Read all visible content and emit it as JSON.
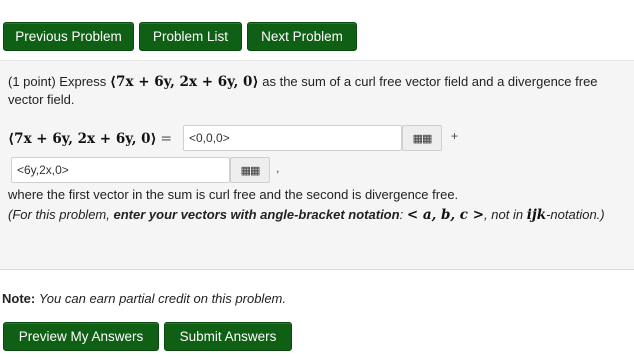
{
  "nav": {
    "previous_label": "Previous Problem",
    "list_label": "Problem List",
    "next_label": "Next Problem"
  },
  "problem": {
    "points": "(1 point) Express",
    "vector": "⟨7x + 6y, 2x + 6y, 0⟩",
    "prompt_tail": "as the sum of a curl free vector field and a divergence free vector field.",
    "equals": "=",
    "answer1_value": "<0,0,0>",
    "answer2_value": "<6y,2x,0>",
    "plus": "+",
    "comma": ",",
    "grid_icon": "▦▦",
    "where_text": "where the first vector in the sum is curl free and the second is divergence free.",
    "instr_pre": "(For this problem,",
    "instr_bold": "enter your vectors with angle-bracket notation",
    "instr_colon": ":",
    "instr_math1": "< a, b, c >",
    "instr_mid": ", not in",
    "instr_math2": "ijk",
    "instr_end": "-notation.)"
  },
  "note": {
    "label": "Note:",
    "text": "You can earn partial credit on this problem."
  },
  "actions": {
    "preview_label": "Preview My Answers",
    "submit_label": "Submit Answers"
  }
}
